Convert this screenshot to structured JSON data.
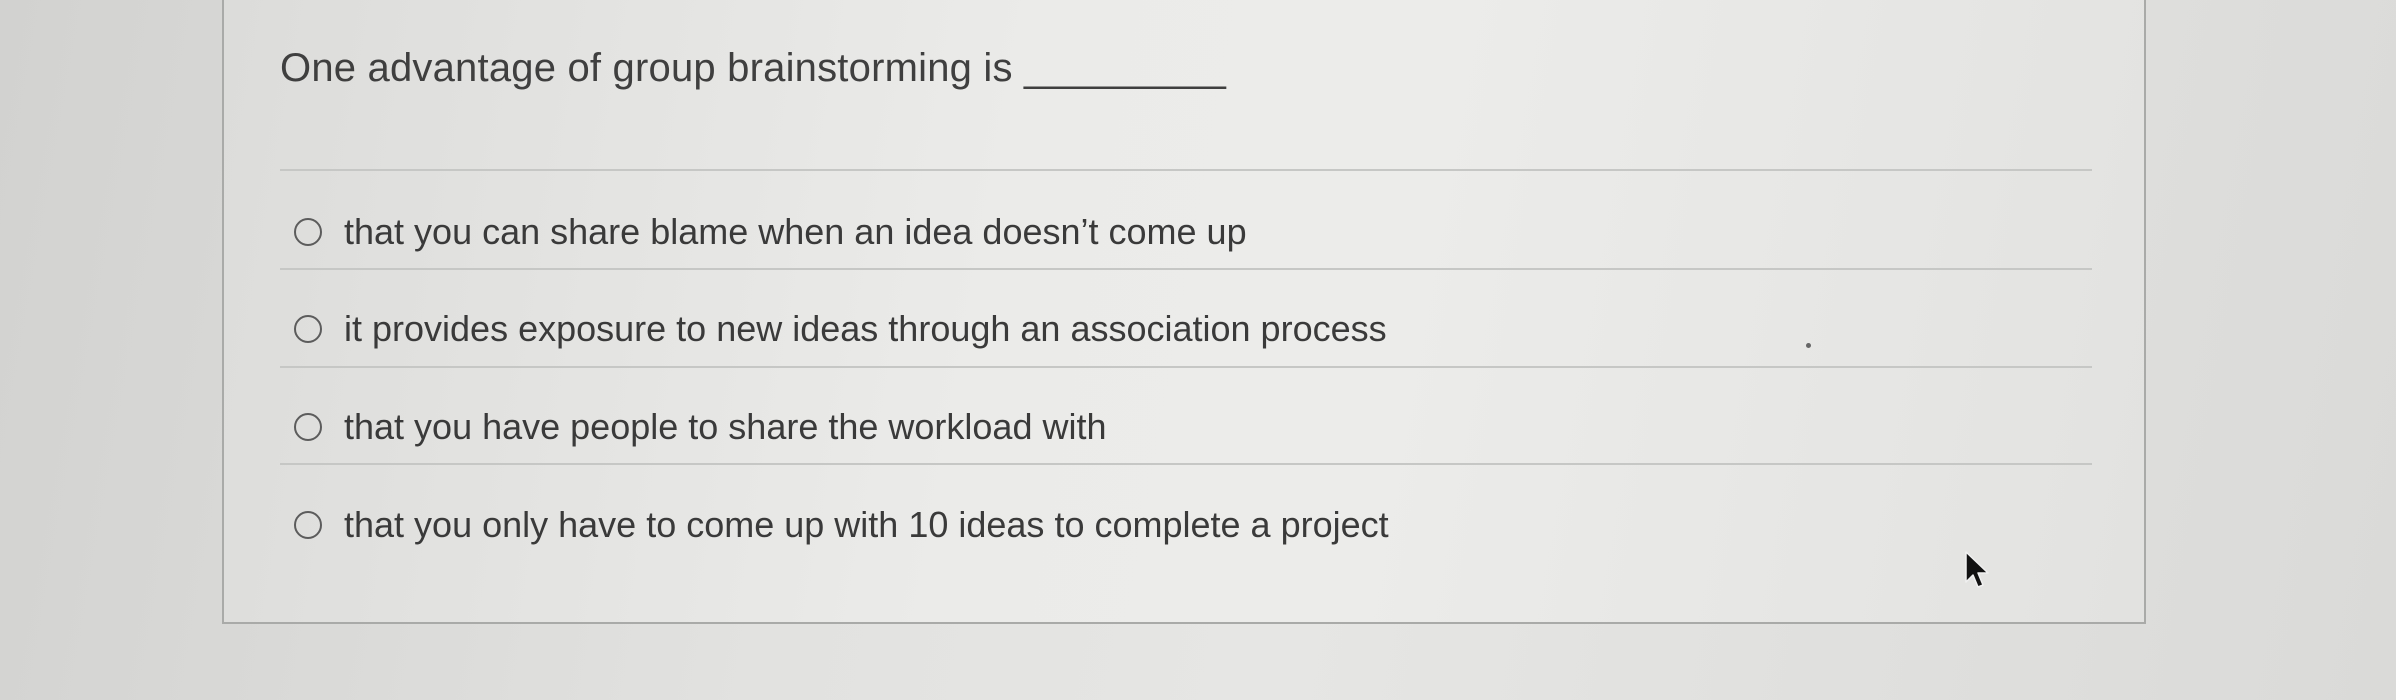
{
  "quiz": {
    "question": "One advantage of group brainstorming is _________",
    "options": [
      {
        "label": "that you can share blame when an idea doesn’t come up",
        "selected": false
      },
      {
        "label": "it provides exposure to new ideas through an association process",
        "selected": false
      },
      {
        "label": "that you have people to share the workload with",
        "selected": false
      },
      {
        "label": "that you only have to come up with 10 ideas to complete a project",
        "selected": false
      }
    ]
  },
  "colors": {
    "text": "#3f3f3f",
    "radio_border": "#5c5c5c",
    "divider": "#c6c7c5",
    "card_border": "#a9aaa8"
  },
  "icons": {
    "cursor": "mouse-pointer-icon",
    "radio": "radio-circle-icon"
  }
}
